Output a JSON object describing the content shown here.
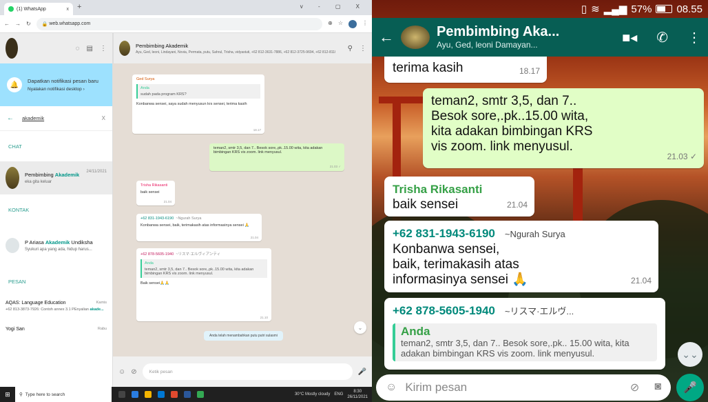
{
  "browser": {
    "tab_title": "(1) WhatsApp",
    "tab_close": "x",
    "new_tab": "+",
    "window_controls": "v - ▢ X",
    "url": "web.whatsapp.com"
  },
  "web_sidebar": {
    "notification_title": "Dapatkan notifikasi pesan baru",
    "notification_sub": "Nyalakan notifikasi desktop ›",
    "search_query": "akademik",
    "search_clear": "X",
    "section_chat": "CHAT",
    "section_kontak": "KONTAK",
    "section_pesan": "PESAN",
    "chat_item": {
      "name_pre": "Pembimbing ",
      "name_hl": "Akademik",
      "date": "24/11/2021",
      "sub": "eka gita keluar"
    },
    "contact_item": {
      "name_pre": "P Ariasa ",
      "name_hl": "Akademik",
      "name_post": " Undiksha",
      "sub": "Syukuri apa yang ada, hidup harus..."
    },
    "pesan_item": {
      "name": "AQAS: Language Education",
      "time": "Kamis",
      "sub_pre": "+62 813-3873-7926: Contoh annex 3.1 PEnyalian ",
      "sub_hl": "akade..."
    },
    "last_item": {
      "name": "Yogi San",
      "time": "Rabu"
    }
  },
  "web_chat": {
    "group_name": "Pembimbing Akademik",
    "members": "Ayu, Ged, leoni, Lindayani, Novia, Permata, putu, Sahrul, Trisha, vidyastuti, +62 812-3631-7886, +62 812-3725-9694, +62 812-8110-2...",
    "msg1": {
      "sender": "Ged Surya",
      "quote_name": "Anda",
      "quote_text": "sudah pada program KRS?",
      "text": "Konbanwa sensei, saya sudah menyusun krs sensei, terima kasih",
      "time": "18.17"
    },
    "msg2": {
      "text": "teman2, smtr 3,5, dan 7.. Besok sore,.pk..15.00 wita, kita adakan bimbingan KRS vis zoom. link menyusul.",
      "time": "21.03 ✓"
    },
    "msg3": {
      "sender": "Trisha Rikasanti",
      "text": "baik sensei",
      "time": "21.04"
    },
    "msg4": {
      "sender": "+62 831-1943-6190",
      "tag": "~Ngurah Surya",
      "text": "Konbanwa sensei, baik, terimakasih atas informasinya sensei 🙏",
      "time": "21.04"
    },
    "msg5": {
      "sender": "+62 878-5605-1940",
      "tag": "~リスマ·エルヴィアンティ",
      "quote_name": "Anda",
      "quote_text": "teman2, smtr 3,5, dan 7.. Besok sore,.pk..15.00 wita, kita adakan bimbingan KRS vis zoom. link menyusul.",
      "text": "Baik sensei🙏🙏",
      "time": "21.10"
    },
    "system_note": "Anda telah menambahkan putu putri sulasmi",
    "composer_placeholder": "Ketik pesan"
  },
  "taskbar": {
    "search_placeholder": "Type here to search",
    "weather": "30°C Mostly cloudy",
    "lang": "ENG",
    "time": "8:30",
    "date": "26/11/2021"
  },
  "phone": {
    "battery": "57%",
    "clock": "08.55",
    "group_name": "Pembimbing Aka...",
    "members": "Ayu, Ged, leoni Damayan...",
    "msg0": {
      "text": "terima kasih",
      "time": "18.17"
    },
    "msg1": {
      "line1": "teman2, smtr 3,5, dan 7..",
      "line2": "Besok sore,.pk..15.00 wita,",
      "line3": "kita adakan bimbingan KRS",
      "line4": "vis zoom. link menyusul.",
      "time": "21.03 ✓"
    },
    "msg2": {
      "sender": "Trisha Rikasanti",
      "text": "baik sensei",
      "time": "21.04"
    },
    "msg3": {
      "sender": "+62 831-1943-6190",
      "tag": "~Ngurah Surya",
      "line1": "Konbanwa sensei,",
      "line2": "baik, terimakasih atas",
      "line3": "informasinya sensei 🙏",
      "time": "21.04"
    },
    "msg4": {
      "sender": "+62 878-5605-1940",
      "tag": "~リスマ·エルヴ...",
      "quote_name": "Anda",
      "quote_text": "teman2, smtr 3,5, dan 7.. Besok sore,.pk.. 15.00 wita, kita adakan bimbingan KRS vis zoom. link menyusul."
    },
    "composer_placeholder": "Kirim pesan"
  },
  "colors": {
    "wa_green_dark": "#075e54",
    "wa_out_bubble": "#dcf8c6",
    "wa_accent": "#009688",
    "notif_blue": "#9de1fe"
  }
}
